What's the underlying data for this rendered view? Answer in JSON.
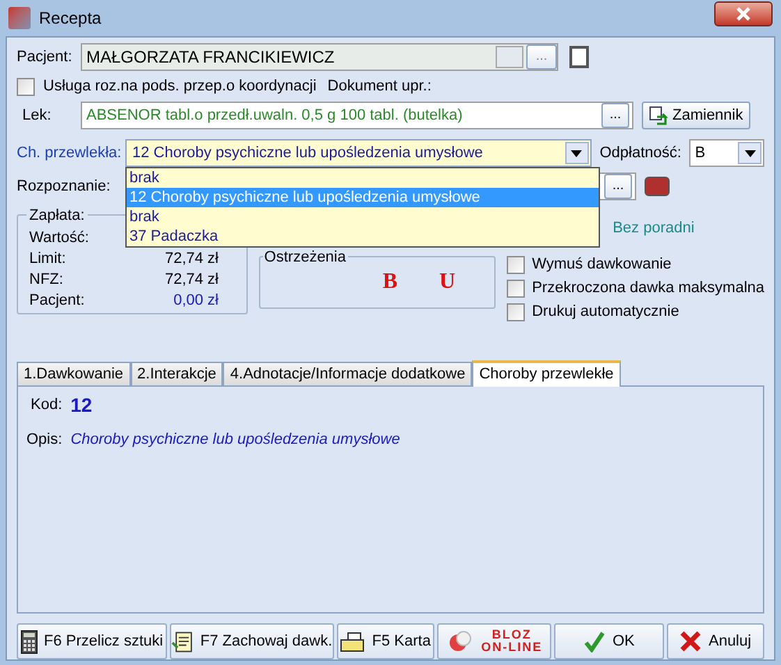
{
  "window": {
    "title": "Recepta"
  },
  "patient": {
    "label": "Pacjent:",
    "value": "MAŁGORZATA FRANCIKIEWICZ",
    "browse": "..."
  },
  "coordination": {
    "label": "Usługa roz.na pods. przep.o koordynacji",
    "checked": false
  },
  "document_label": "Dokument upr.:",
  "drug": {
    "label": "Lek:",
    "value": "ABSENOR tabl.o przedł.uwaln. 0,5 g 100 tabl. (butelka)",
    "browse": "...",
    "substitute_button": "Zamiennik"
  },
  "chronic": {
    "label": "Ch. przewlekła:",
    "value": "12 Choroby psychiczne lub upośledzenia umysłowe",
    "expanded": true,
    "options": [
      {
        "label": "brak",
        "selected": false
      },
      {
        "label": "12 Choroby psychiczne lub upośledzenia umysłowe",
        "selected": true
      },
      {
        "label": "brak",
        "selected": false
      },
      {
        "label": "37 Padaczka",
        "selected": false
      }
    ]
  },
  "payment_level": {
    "label": "Odpłatność:",
    "value": "B"
  },
  "diagnosis": {
    "label": "Rozpoznanie:",
    "browse": "..."
  },
  "payment": {
    "title": "Zapłata:",
    "rows": [
      {
        "label": "Wartość:",
        "highlight": false
      },
      {
        "label": "Limit:",
        "value": "72,74 zł",
        "highlight": false
      },
      {
        "label": "NFZ:",
        "value": "72,74 zł",
        "highlight": false
      },
      {
        "label": "Pacjent:",
        "value": "0,00 zł",
        "highlight": true
      }
    ]
  },
  "clinic_note": "Bez poradni",
  "warnings": {
    "title": "Ostrzeżenia",
    "marks": [
      "B",
      "U"
    ]
  },
  "options": [
    {
      "label": "Wymuś dawkowanie",
      "checked": false
    },
    {
      "label": "Przekroczona dawka maksymalna",
      "checked": false
    },
    {
      "label": "Drukuj automatycznie",
      "checked": false
    }
  ],
  "tabs": [
    {
      "label": "1.Dawkowanie",
      "selected": false
    },
    {
      "label": "2.Interakcje",
      "selected": false
    },
    {
      "label": "4.Adnotacje/Informacje dodatkowe",
      "selected": false
    },
    {
      "label": "Choroby przewlekłe",
      "selected": true
    }
  ],
  "tab_content": {
    "code_label": "Kod:",
    "code": "12",
    "description_label": "Opis:",
    "description": "Choroby psychiczne lub upośledzenia umysłowe"
  },
  "buttons": [
    {
      "kind": "calc",
      "label": "F6 Przelicz sztuki"
    },
    {
      "kind": "save",
      "label": "F7 Zachowaj dawk."
    },
    {
      "kind": "card",
      "label": "F5 Karta"
    },
    {
      "kind": "bloz",
      "label": "BLOZ\nON-LINE"
    },
    {
      "kind": "ok",
      "label": "OK"
    },
    {
      "kind": "cancel",
      "label": "Anuluj"
    }
  ]
}
